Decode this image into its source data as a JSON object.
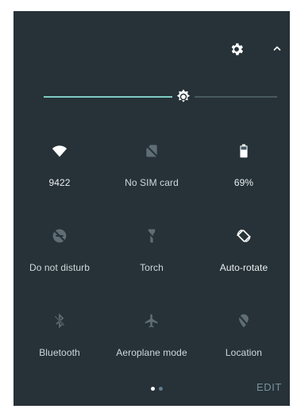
{
  "header": {
    "settings_icon": "gear-icon",
    "collapse_icon": "chevron-up-icon"
  },
  "brightness": {
    "level": 0.6,
    "icon": "brightness-icon"
  },
  "tiles": [
    {
      "label": "9422",
      "icon": "wifi-icon",
      "active": true
    },
    {
      "label": "No SIM card",
      "icon": "no-sim-icon",
      "active": false
    },
    {
      "label": "69%",
      "icon": "battery-icon",
      "active": true
    },
    {
      "label": "Do not disturb",
      "icon": "do-not-disturb-icon",
      "active": false
    },
    {
      "label": "Torch",
      "icon": "torch-icon",
      "active": false
    },
    {
      "label": "Auto-rotate",
      "icon": "auto-rotate-icon",
      "active": true
    },
    {
      "label": "Bluetooth",
      "icon": "bluetooth-off-icon",
      "active": false
    },
    {
      "label": "Aeroplane mode",
      "icon": "airplane-icon",
      "active": false
    },
    {
      "label": "Location",
      "icon": "location-off-icon",
      "active": false
    }
  ],
  "pager": {
    "pages": 2,
    "current": 1
  },
  "footer": {
    "edit_label": "EDIT"
  },
  "colors": {
    "panel_bg": "#263238",
    "accent": "#80cbc4",
    "icon_active": "#ffffff",
    "icon_inactive": "#5f6d74"
  }
}
